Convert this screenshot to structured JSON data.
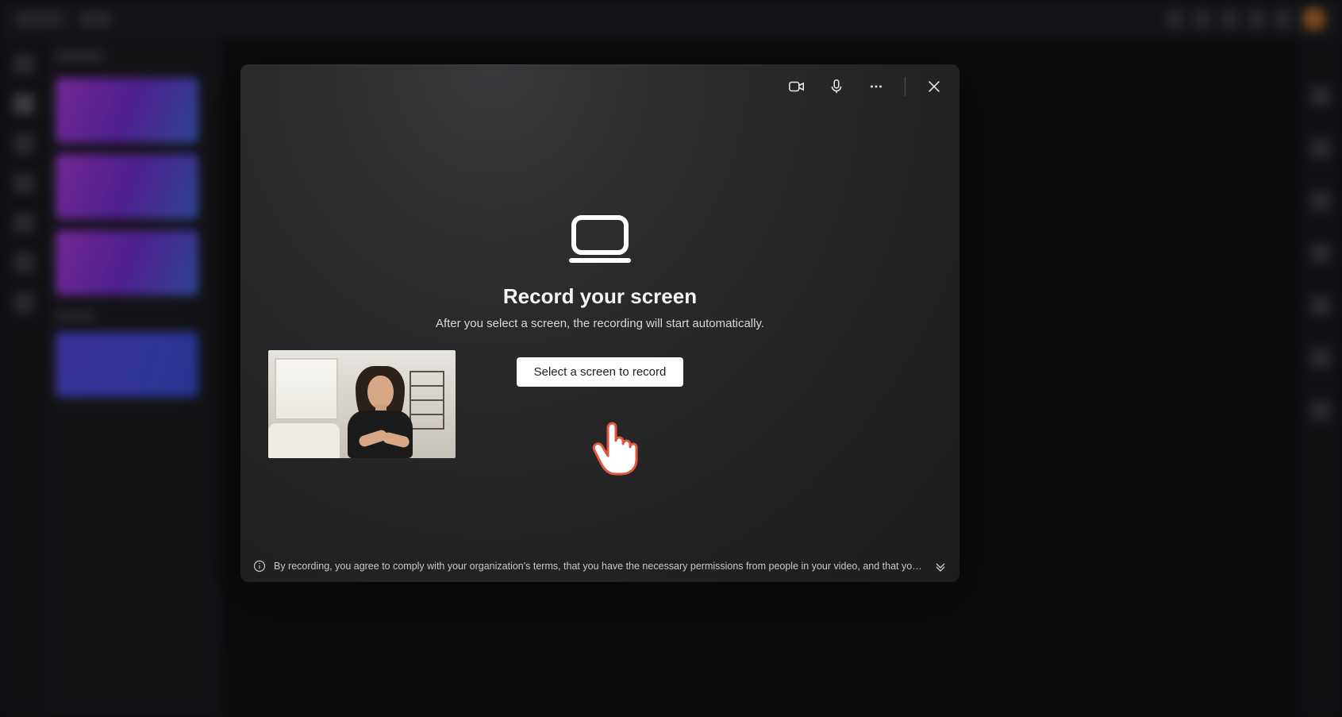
{
  "modal": {
    "title": "Record your screen",
    "subtitle": "After you select a screen, the recording will start automatically.",
    "select_button": "Select a screen to record",
    "disclaimer": "By recording, you agree to comply with your organization's terms, that you have the necessary permissions from people in your video, and that you will respect the copyright a...",
    "toolbar": {
      "camera_icon": "video-camera-icon",
      "mic_icon": "microphone-icon",
      "more_icon": "more-options-icon",
      "close_icon": "close-icon"
    }
  },
  "cursor": {
    "name": "pointer-hand-cursor"
  }
}
